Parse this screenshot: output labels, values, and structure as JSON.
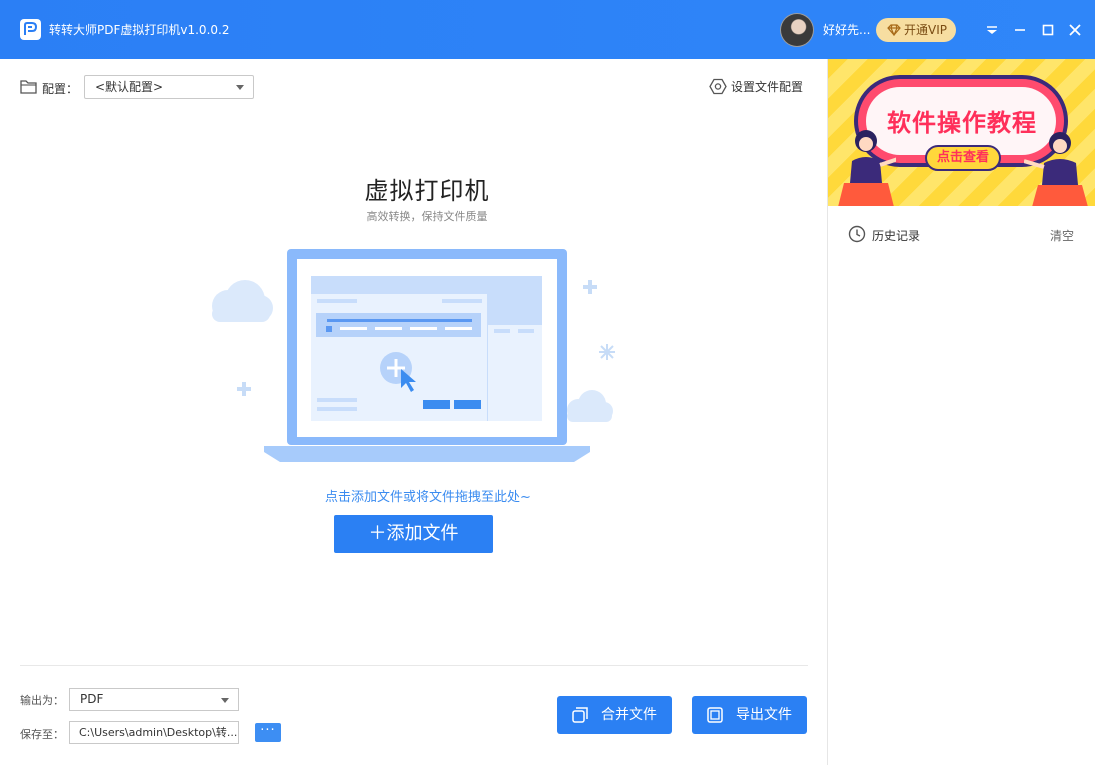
{
  "titlebar": {
    "app_title": "转转大师PDF虚拟打印机v1.0.0.2",
    "user_name": "好好先...",
    "vip_label": "开通VIP",
    "accent": "#2b7ff5"
  },
  "config": {
    "label": "配置：",
    "selected": "<默认配置>",
    "file_config_label": "设置文件配置"
  },
  "main": {
    "title": "虚拟打印机",
    "subtitle": "高效转换，保持文件质量",
    "drop_hint": "点击添加文件或将文件拖拽至此处~",
    "add_button": "＋添加文件"
  },
  "bottom": {
    "output_label": "输出为：",
    "output_value": "PDF",
    "save_label": "保存至：",
    "save_path": "C:\\Users\\admin\\Desktop\\转...",
    "browse_label": "···",
    "merge_button": "合并文件",
    "export_button": "导出文件"
  },
  "sidebar": {
    "banner_title": "软件操作教程",
    "banner_button": "点击查看",
    "history_label": "历史记录",
    "clear_label": "清空"
  },
  "icons": [
    "app-logo-icon",
    "diamond-icon",
    "dropdown-icon",
    "minimize-icon",
    "maximize-icon",
    "close-icon",
    "folder-icon",
    "settings-hex-icon",
    "merge-icon",
    "export-icon",
    "clock-icon"
  ]
}
